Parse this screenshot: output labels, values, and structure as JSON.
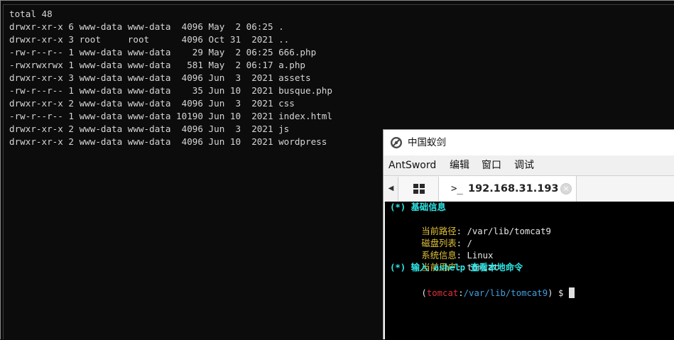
{
  "terminal": {
    "lines": [
      "total 48",
      "drwxr-xr-x 6 www-data www-data  4096 May  2 06:25 .",
      "drwxr-xr-x 3 root     root      4096 Oct 31  2021 ..",
      "-rw-r--r-- 1 www-data www-data    29 May  2 06:25 666.php",
      "-rwxrwxrwx 1 www-data www-data   581 May  2 06:17 a.php",
      "drwxr-xr-x 3 www-data www-data  4096 Jun  3  2021 assets",
      "-rw-r--r-- 1 www-data www-data    35 Jun 10  2021 busque.php",
      "drwxr-xr-x 2 www-data www-data  4096 Jun  3  2021 css",
      "-rw-r--r-- 1 www-data www-data 10190 Jun 10  2021 index.html",
      "drwxr-xr-x 2 www-data www-data  4096 Jun  3  2021 js",
      "drwxr-xr-x 2 www-data www-data  4096 Jun 10  2021 wordpress"
    ]
  },
  "antsword": {
    "title": "中国蚁剑",
    "menu": [
      "AntSword",
      "编辑",
      "窗口",
      "调试"
    ],
    "tab": {
      "prompt_icon": ">_",
      "label": "192.168.31.193",
      "close_glyph": "×"
    },
    "console": {
      "info_header": "(*) 基础信息",
      "rows": [
        {
          "key": "当前路径",
          "sep": ": ",
          "value": "/var/lib/tomcat9"
        },
        {
          "key": "磁盘列表",
          "sep": ": ",
          "value": "/"
        },
        {
          "key": "系统信息",
          "sep": ": ",
          "value": "Linux"
        },
        {
          "key": "当前用户",
          "sep": ": ",
          "value": "tomcat"
        }
      ],
      "help_hint": "(*) 输入 ashelp 查看本地命令",
      "prompt": {
        "open": "(",
        "user": "tomcat",
        "colon": ":",
        "path": "/var/lib/tomcat9",
        "close": ")",
        "symbol": "$"
      }
    }
  },
  "colors": {
    "terminal_bg": "#0c0c0c",
    "terminal_text": "#d6d6d6",
    "console_cyan": "#2ee6e6",
    "console_yellow": "#e1c238",
    "console_red": "#e0303a",
    "console_blue": "#3fa0e0"
  }
}
